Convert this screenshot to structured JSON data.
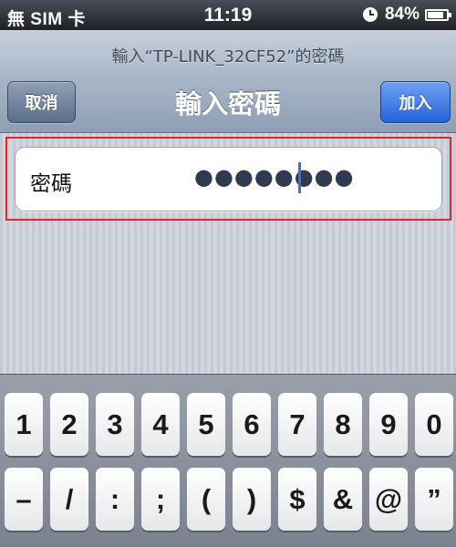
{
  "status_bar": {
    "carrier": "無 SIM 卡",
    "time": "11:19",
    "battery_percent": "84%",
    "battery_level": 0.84,
    "icons": [
      "clock-icon",
      "battery-icon"
    ]
  },
  "nav": {
    "prompt": "輸入“TP-LINK_32CF52”的密碼",
    "title": "輸入密碼",
    "cancel_label": "取消",
    "join_label": "加入"
  },
  "password": {
    "label": "密碼",
    "masked_value": "●●●●●●●●"
  },
  "keyboard": {
    "row1": [
      "1",
      "2",
      "3",
      "4",
      "5",
      "6",
      "7",
      "8",
      "9",
      "0"
    ],
    "row2": [
      "–",
      "/",
      ":",
      ";",
      "(",
      ")",
      "$",
      "&",
      "@",
      "”"
    ]
  },
  "colors": {
    "highlight_border": "#e0242c",
    "join_button": "#2464d8",
    "caret": "#3d6fe0"
  }
}
